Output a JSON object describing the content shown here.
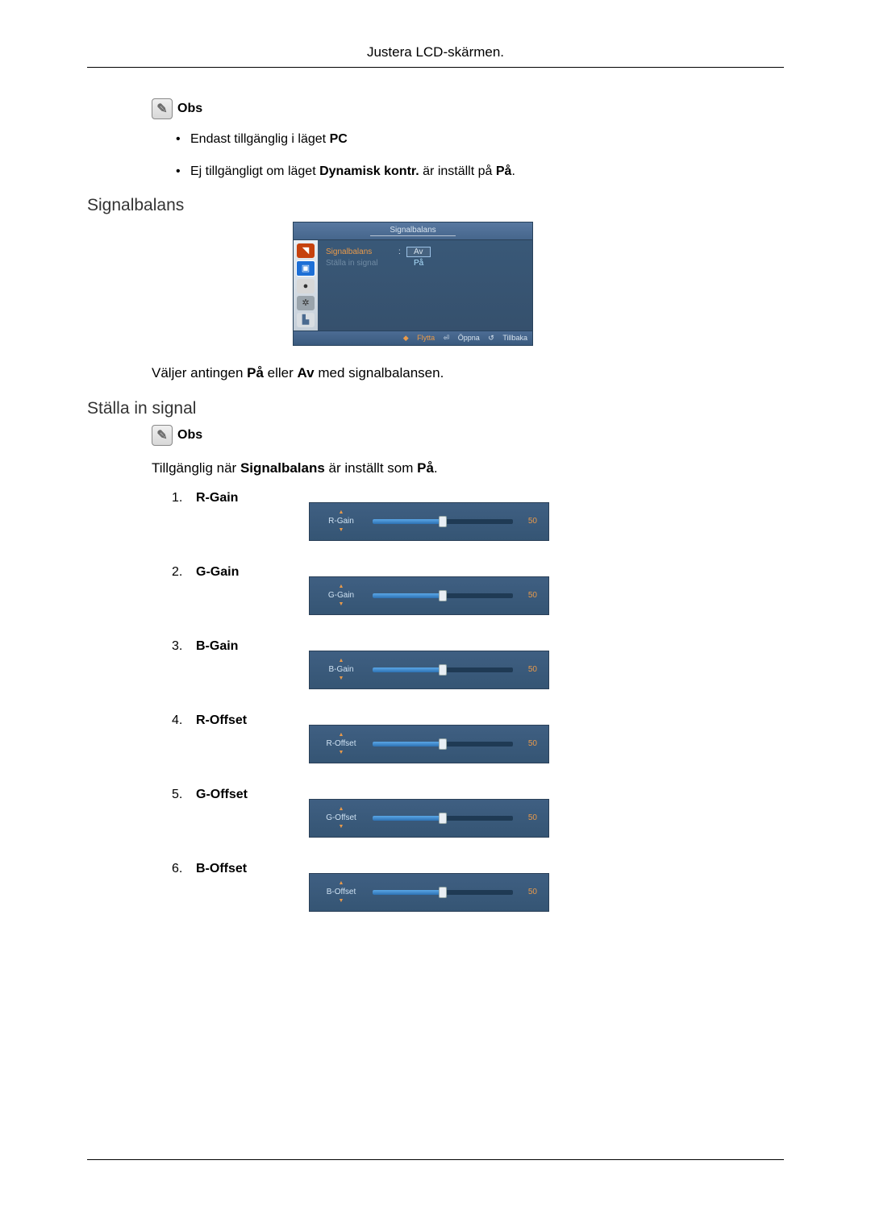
{
  "title": "Justera LCD-skärmen.",
  "note_label": "Obs",
  "note_bullets": [
    {
      "pre": "Endast tillgänglig i läget ",
      "b1": "PC",
      "post": ""
    },
    {
      "pre": "Ej tillgängligt om läget ",
      "b1": "Dynamisk kontr.",
      "mid": " är inställt på ",
      "b2": "På",
      "post": "."
    }
  ],
  "section_signalbalans": "Signalbalans",
  "osd": {
    "title": "Signalbalans",
    "row1_label": "Signalbalans",
    "row1_sep": ":",
    "row1_opt1": "Av",
    "row1_opt2": "På",
    "row2_label": "Ställa in signal",
    "footer_move": "Flytta",
    "footer_open": "Öppna",
    "footer_back": "Tillbaka"
  },
  "caption_signalbalans": {
    "pre": "Väljer antingen ",
    "b1": "På",
    "mid": " eller ",
    "b2": "Av",
    "post": " med signalbalansen."
  },
  "section_stalla": "Ställa in signal",
  "note2_text": {
    "pre": "Tillgänglig när ",
    "b1": "Signalbalans",
    "mid": " är inställt som ",
    "b2": "På",
    "post": "."
  },
  "chart_data": {
    "type": "table",
    "items": [
      {
        "name": "R-Gain",
        "value": 50,
        "min": 0,
        "max": 100
      },
      {
        "name": "G-Gain",
        "value": 50,
        "min": 0,
        "max": 100
      },
      {
        "name": "B-Gain",
        "value": 50,
        "min": 0,
        "max": 100
      },
      {
        "name": "R-Offset",
        "value": 50,
        "min": 0,
        "max": 100
      },
      {
        "name": "G-Offset",
        "value": 50,
        "min": 0,
        "max": 100
      },
      {
        "name": "B-Offset",
        "value": 50,
        "min": 0,
        "max": 100
      }
    ]
  }
}
